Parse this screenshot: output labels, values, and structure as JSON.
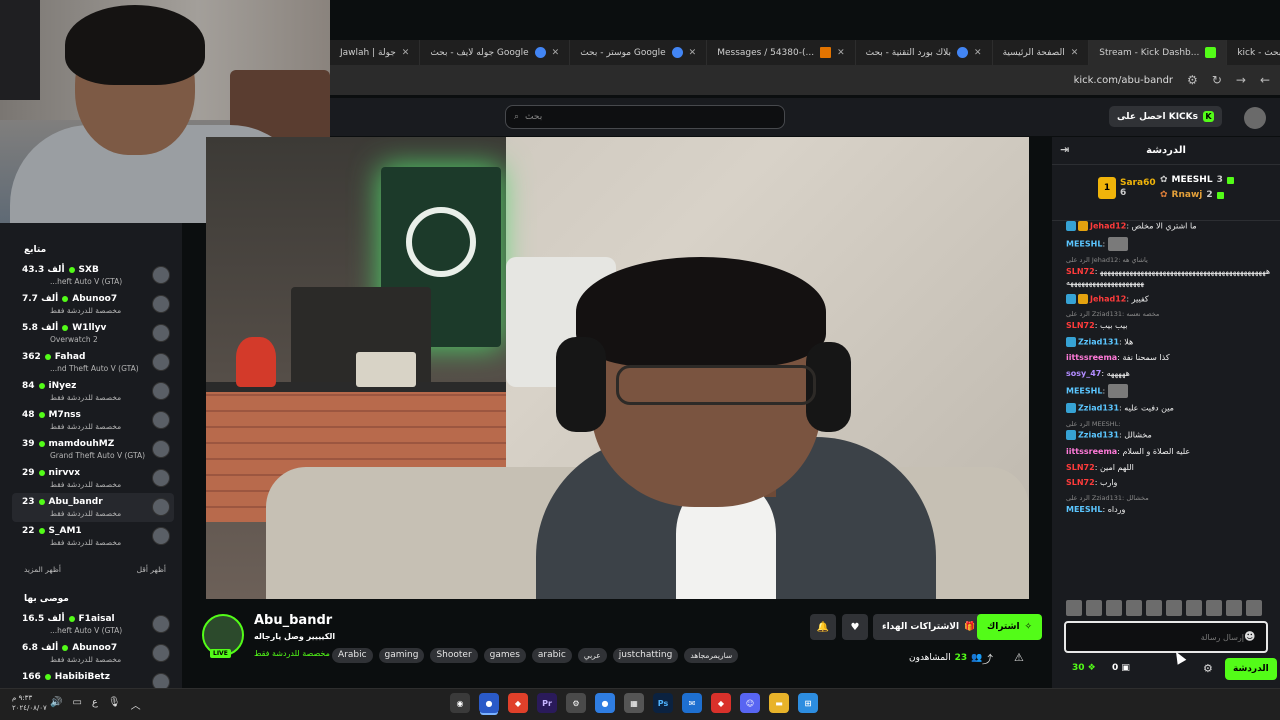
{
  "browser": {
    "tabs": [
      {
        "label": "Jawlah | جولة",
        "icon": "site-icon"
      },
      {
        "label": "جوله لايف - بحث Google",
        "icon": "google-icon"
      },
      {
        "label": "موستر - بحث Google",
        "icon": "google-icon"
      },
      {
        "label": "Messages / 54380-(...",
        "icon": "bars-icon"
      },
      {
        "label": "بلاك بورد التقنية - بحث",
        "icon": "google-icon"
      },
      {
        "label": "الصفحة الرئيسية",
        "icon": "site-icon"
      },
      {
        "label": "Stream - Kick Dashb...",
        "icon": "kick-icon"
      },
      {
        "label": "kick - بحث Google",
        "icon": "google-icon"
      }
    ],
    "url": "kick.com/abu-bandr"
  },
  "header": {
    "search_placeholder": "بحث",
    "kicks_label": "احصل على KICKs"
  },
  "sidebar": {
    "title": "متابع",
    "channels": [
      {
        "viewers": "43.3 ألف",
        "name": "SXB",
        "category": "...heft Auto V (GTA)"
      },
      {
        "viewers": "7.7 ألف",
        "name": "Abunoo7",
        "category": "مخصصة للدردشة فقط"
      },
      {
        "viewers": "5.8 ألف",
        "name": "W1llyv",
        "category": "Overwatch 2"
      },
      {
        "viewers": "362",
        "name": "Fahad",
        "category": "...nd Theft Auto V (GTA)"
      },
      {
        "viewers": "84",
        "name": "iNyez",
        "category": "مخصصة للدردشة فقط"
      },
      {
        "viewers": "48",
        "name": "M7nss",
        "category": "مخصصة للدردشة فقط"
      },
      {
        "viewers": "39",
        "name": "mamdouhMZ",
        "category": "Grand Theft Auto V (GTA)"
      },
      {
        "viewers": "29",
        "name": "nirvvx",
        "category": "مخصصة للدردشة فقط"
      },
      {
        "viewers": "23",
        "name": "Abu_bandr",
        "category": "مخصصة للدردشة فقط"
      },
      {
        "viewers": "22",
        "name": "S_AM1",
        "category": "مخصصة للدردشة فقط"
      }
    ],
    "show_less": "أظهر أقل",
    "show_more": "أظهر المزيد",
    "recommended_title": "موصى بها",
    "recommended": [
      {
        "viewers": "16.5 ألف",
        "name": "F1aisal",
        "category": "...heft Auto V (GTA)"
      },
      {
        "viewers": "6.8 ألف",
        "name": "Abunoo7",
        "category": "مخصصة للدردشة فقط"
      },
      {
        "viewers": "166",
        "name": "HabibiBetz",
        "category": ""
      }
    ]
  },
  "channel": {
    "name": "Abu_bandr",
    "title": "الكيييير وصل يارجاله",
    "category": "مخصصة للدردشة فقط",
    "live": "LIVE",
    "tags": [
      "Arabic",
      "gaming",
      "Shooter",
      "games",
      "arabic",
      "عربي",
      "justchatting",
      "ساريمرمجاهد"
    ],
    "subscribe_label": "اشتراك",
    "gift_label": "الاشتراكات الهداء",
    "viewers_label": "المشاهدون",
    "viewers_count": "23"
  },
  "chat": {
    "title": "الدردشة",
    "leaderboard": [
      {
        "name": "MEESHL",
        "value": "3"
      },
      {
        "name": "Rnawj",
        "value": "2"
      },
      {
        "name": "Sara60",
        "value": "6"
      }
    ],
    "messages": [
      {
        "reply": "",
        "user": "Jehad12",
        "color": "#ff3b3b",
        "text": "ما اشتري الا مخلص",
        "badge": "blue-gold"
      },
      {
        "reply": "",
        "user": "MEESHL",
        "color": "#5bc6ff",
        "text": "",
        "emote": true
      },
      {
        "reply": "الرد على Jehad12: ياشاي هه",
        "user": "SLN72",
        "color": "#ff3b3b",
        "text": "ههههههههههههههههههههههههههههههههههههههههههههههههههههههههههههههههههه"
      },
      {
        "reply": "",
        "user": "Jehad12",
        "color": "#ff3b3b",
        "text": "كفيير",
        "badge": "blue-gold"
      },
      {
        "reply": "الرد على Zziad131: مخصه نعسه",
        "user": "SLN72",
        "color": "#ff3b3b",
        "text": "بيب بيب"
      },
      {
        "reply": "",
        "user": "Zziad131",
        "color": "#5bc6ff",
        "text": "هلا",
        "badge": "blue"
      },
      {
        "reply": "",
        "user": "iittssreema",
        "color": "#ff7ad9",
        "text": "كذا سمحنا نفة"
      },
      {
        "reply": "",
        "user": "sosy_47",
        "color": "#b28cff",
        "text": "هههههه"
      },
      {
        "reply": "",
        "user": "MEESHL",
        "color": "#5bc6ff",
        "text": "",
        "emote": true
      },
      {
        "reply": "",
        "user": "Zziad131",
        "color": "#5bc6ff",
        "text": "مين دفيت عليه",
        "badge": "blue"
      },
      {
        "reply": "الرد على MEESHL:",
        "user": "Zziad131",
        "color": "#5bc6ff",
        "text": "مخشالل",
        "badge": "blue"
      },
      {
        "reply": "",
        "user": "iittssreema",
        "color": "#ff7ad9",
        "text": "عليه الصلاة و السلام"
      },
      {
        "reply": "",
        "user": "SLN72",
        "color": "#ff3b3b",
        "text": "اللهم امين"
      },
      {
        "reply": "",
        "user": "SLN72",
        "color": "#ff3b3b",
        "text": "وارب"
      },
      {
        "reply": "الرد على Zziad131: مخشالل",
        "user": "MEESHL",
        "color": "#5bc6ff",
        "text": "ورداه"
      }
    ],
    "input_placeholder": "إرسال رسالة",
    "points": "30",
    "gifts": "0",
    "send_label": "الدردشة"
  },
  "taskbar": {
    "time": "٩:٣٣ م",
    "date": "٢٠٢٤/٠٨/٠٧",
    "lang": "ع"
  }
}
